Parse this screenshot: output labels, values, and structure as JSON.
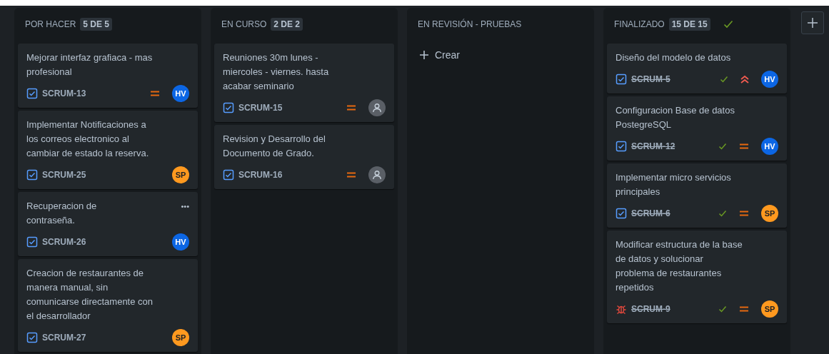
{
  "columns": [
    {
      "title": "POR HACER",
      "count": "5 DE 5",
      "complete": false,
      "cards": [
        {
          "title": "Mejorar interfaz grafiaca - mas profesional",
          "key": "SCRUM-13",
          "kind": "story",
          "done": false,
          "priority_high": false,
          "priority_medium": true,
          "assignee": {
            "initials": "HV",
            "color": "#0c66e4"
          }
        },
        {
          "title": "Implementar Notificaciones a los correos electronico al cambiar de estado la reserva.",
          "key": "SCRUM-25",
          "kind": "story",
          "done": false,
          "priority_high": false,
          "priority_medium": false,
          "assignee": {
            "initials": "SP",
            "color": "#ff991f"
          }
        },
        {
          "title": "Recuperacion de contraseña.",
          "key": "SCRUM-26",
          "kind": "story",
          "done": false,
          "priority_high": false,
          "priority_medium": false,
          "assignee": {
            "initials": "HV",
            "color": "#0c66e4"
          },
          "menu": "•••"
        },
        {
          "title": "Creacion de restaurantes de manera manual, sin comunicarse directamente con el desarrollador",
          "key": "SCRUM-27",
          "kind": "story",
          "done": false,
          "priority_high": false,
          "priority_medium": false,
          "assignee": {
            "initials": "SP",
            "color": "#ff991f"
          }
        }
      ]
    },
    {
      "title": "EN CURSO",
      "count": "2 DE 2",
      "complete": false,
      "cards": [
        {
          "title": "Reuniones 30m lunes - miercoles - viernes. hasta acabar seminario",
          "key": "SCRUM-15",
          "kind": "story",
          "done": false,
          "priority_high": false,
          "priority_medium": true
        },
        {
          "title": "Revision y Desarrollo del Documento de Grado.",
          "key": "SCRUM-16",
          "kind": "story",
          "done": false,
          "priority_high": false,
          "priority_medium": true
        }
      ]
    },
    {
      "title": "EN REVISIÓN - PRUEBAS",
      "complete": false,
      "create_label": "Crear"
    },
    {
      "title": "FINALIZADO",
      "count": "15 DE 15",
      "complete": true,
      "cards": [
        {
          "title": "Diseño del modelo de datos",
          "key": "SCRUM-5",
          "kind": "story",
          "done": true,
          "priority_high": true,
          "priority_medium": false,
          "assignee": {
            "initials": "HV",
            "color": "#0c66e4"
          }
        },
        {
          "title": "Configuracion Base de datos PostegreSQL",
          "key": "SCRUM-12",
          "kind": "story",
          "done": true,
          "priority_high": false,
          "priority_medium": true,
          "assignee": {
            "initials": "HV",
            "color": "#0c66e4"
          }
        },
        {
          "title": "Implementar micro servicios principales",
          "key": "SCRUM-6",
          "kind": "story",
          "done": true,
          "priority_high": false,
          "priority_medium": true,
          "assignee": {
            "initials": "SP",
            "color": "#ff991f"
          }
        },
        {
          "title": "Modificar estructura de la base de datos y solucionar problema de restaurantes repetidos",
          "key": "SCRUM-9",
          "kind": "bug",
          "done": true,
          "priority_high": false,
          "priority_medium": true,
          "assignee": {
            "initials": "SP",
            "color": "#ff991f"
          }
        }
      ]
    }
  ]
}
